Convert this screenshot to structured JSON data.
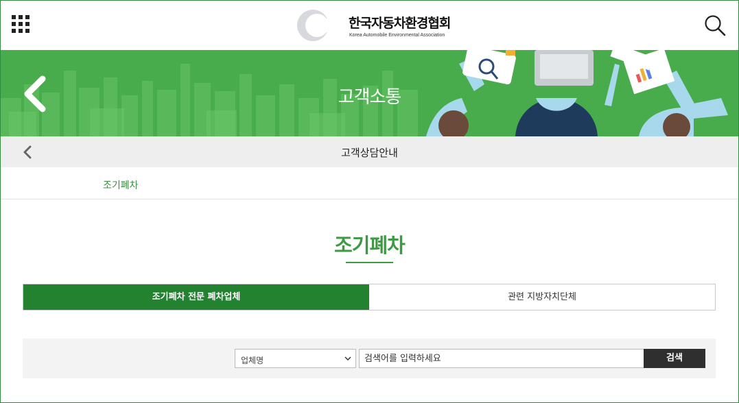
{
  "header": {
    "logo_name": "한국자동차환경협회",
    "logo_sub": "Korea Automobile Environmental Association",
    "menu_icon": "grid-menu-icon",
    "search_icon": "search-icon"
  },
  "banner": {
    "title": "고객소통",
    "background_color": "#49ac4c",
    "back_icon": "chevron-left-icon"
  },
  "subnav": {
    "title": "고객상담안내"
  },
  "category": {
    "link_label": "조기폐차"
  },
  "page": {
    "title": "조기폐차",
    "accent_color": "#3c9a42"
  },
  "tabs": [
    {
      "label": "조기폐차 전문 폐차업체",
      "active": true
    },
    {
      "label": "관련 지방자치단체",
      "active": false
    }
  ],
  "search": {
    "select_value": "업체명",
    "placeholder": "검색어를 입력하세요",
    "button_label": "검색"
  }
}
